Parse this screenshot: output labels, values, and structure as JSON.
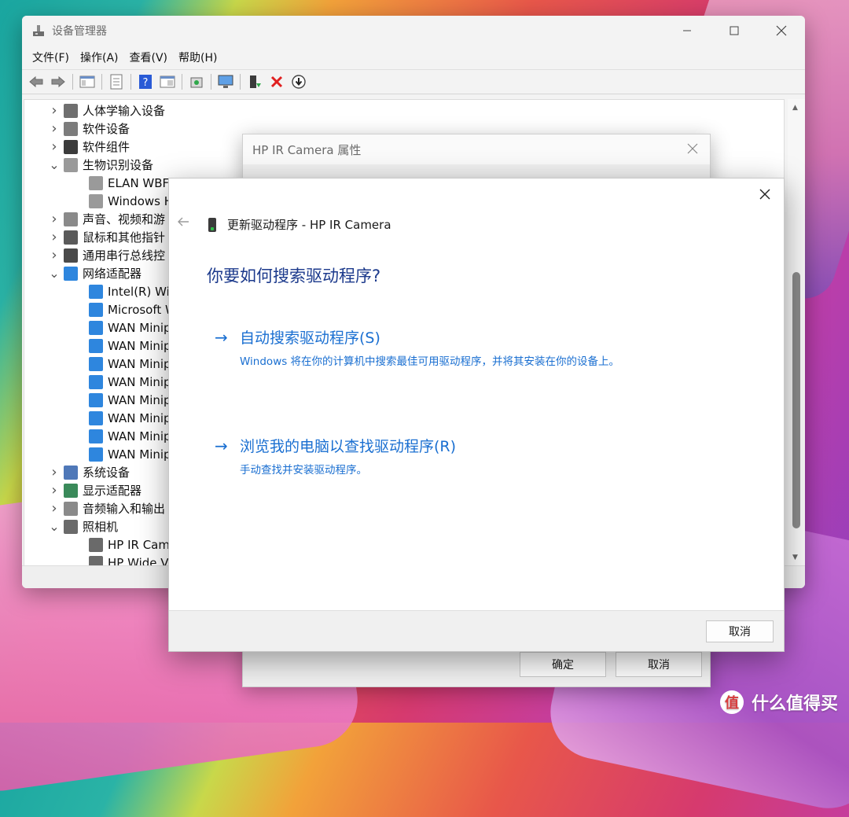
{
  "colors": {
    "accent": "#1a6fd1",
    "question": "#1c3a8c",
    "error_red": "#e02020"
  },
  "device_manager": {
    "title": "设备管理器",
    "menu": [
      "文件(F)",
      "操作(A)",
      "查看(V)",
      "帮助(H)"
    ],
    "tree": [
      {
        "label": "人体学输入设备",
        "expanded": false,
        "icon": "hid-icon"
      },
      {
        "label": "软件设备",
        "expanded": false,
        "icon": "software-device-icon"
      },
      {
        "label": "软件组件",
        "expanded": false,
        "icon": "software-component-icon"
      },
      {
        "label": "生物识别设备",
        "expanded": true,
        "icon": "fingerprint-icon"
      },
      {
        "label": "ELAN WBF",
        "child": true,
        "icon": "fingerprint-icon"
      },
      {
        "label": "Windows H",
        "child": true,
        "icon": "fingerprint-icon"
      },
      {
        "label": "声音、视频和游",
        "expanded": false,
        "icon": "speaker-icon"
      },
      {
        "label": "鼠标和其他指针",
        "expanded": false,
        "icon": "mouse-icon"
      },
      {
        "label": "通用串行总线控",
        "expanded": false,
        "icon": "usb-icon"
      },
      {
        "label": "网络适配器",
        "expanded": true,
        "icon": "network-icon"
      },
      {
        "label": "Intel(R) Wi-",
        "child": true,
        "icon": "network-icon"
      },
      {
        "label": "Microsoft W",
        "child": true,
        "icon": "network-icon"
      },
      {
        "label": "WAN Minip",
        "child": true,
        "icon": "network-icon"
      },
      {
        "label": "WAN Minip",
        "child": true,
        "icon": "network-icon"
      },
      {
        "label": "WAN Minip",
        "child": true,
        "icon": "network-icon"
      },
      {
        "label": "WAN Minip",
        "child": true,
        "icon": "network-icon"
      },
      {
        "label": "WAN Minip",
        "child": true,
        "icon": "network-icon"
      },
      {
        "label": "WAN Minip",
        "child": true,
        "icon": "network-icon"
      },
      {
        "label": "WAN Minip",
        "child": true,
        "icon": "network-icon"
      },
      {
        "label": "WAN Minip",
        "child": true,
        "icon": "network-icon"
      },
      {
        "label": "系统设备",
        "expanded": false,
        "icon": "system-device-icon"
      },
      {
        "label": "显示适配器",
        "expanded": false,
        "icon": "display-adapter-icon"
      },
      {
        "label": "音频输入和输出",
        "expanded": false,
        "icon": "speaker-icon"
      },
      {
        "label": "照相机",
        "expanded": true,
        "icon": "camera-icon"
      },
      {
        "label": "HP IR Came",
        "child": true,
        "icon": "camera-icon"
      },
      {
        "label": "HP Wide Vi",
        "child": true,
        "icon": "camera-icon"
      }
    ]
  },
  "properties_dialog": {
    "title": "HP IR Camera 属性",
    "ok_label": "确定",
    "cancel_label": "取消"
  },
  "wizard": {
    "header": "更新驱动程序 - HP IR Camera",
    "question": "你要如何搜索驱动程序?",
    "option_auto": {
      "label": "自动搜索驱动程序(S)",
      "desc": "Windows 将在你的计算机中搜索最佳可用驱动程序，并将其安装在你的设备上。"
    },
    "option_browse": {
      "label": "浏览我的电脑以查找驱动程序(R)",
      "desc": "手动查找并安装驱动程序。"
    },
    "cancel_label": "取消"
  },
  "watermark": {
    "text": "什么值得买",
    "logo_glyph": "值"
  }
}
